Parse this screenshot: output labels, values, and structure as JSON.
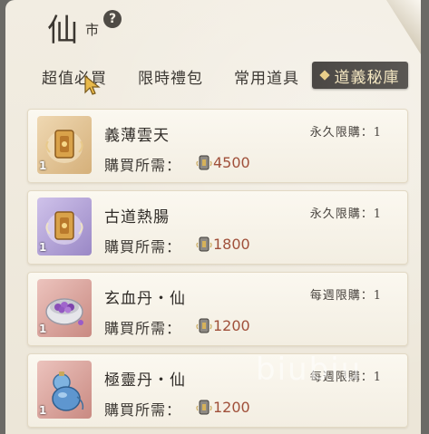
{
  "header": {
    "title_main": "仙",
    "title_sub": "市",
    "help_glyph": "?"
  },
  "tabs": [
    {
      "label": "超值必買",
      "active": false
    },
    {
      "label": "限時禮包",
      "active": false
    },
    {
      "label": "常用道具",
      "active": false
    },
    {
      "label": "道義秘庫",
      "active": true
    }
  ],
  "cost_label": "購買所需：",
  "items": [
    {
      "name": "義薄雲天",
      "limit": "永久限購：1",
      "quantity": "1",
      "price": "4500",
      "icon": "gold-token-icon"
    },
    {
      "name": "古道熱腸",
      "limit": "永久限購：1",
      "quantity": "1",
      "price": "1800",
      "icon": "gold-token-icon"
    },
    {
      "name": "玄血丹・仙",
      "limit": "每週限購：1",
      "quantity": "1",
      "price": "1200",
      "icon": "purple-pill-bowl-icon"
    },
    {
      "name": "極靈丹・仙",
      "limit": "每週限購：1",
      "quantity": "1",
      "price": "1200",
      "icon": "blue-gourd-icon"
    }
  ],
  "currency_icon": "daoyi-token-icon",
  "watermark": "biubiu",
  "colors": {
    "active_tab_bg": "#4b4845",
    "active_tab_text": "#f4e7c2",
    "price_text": "#a0503a"
  }
}
